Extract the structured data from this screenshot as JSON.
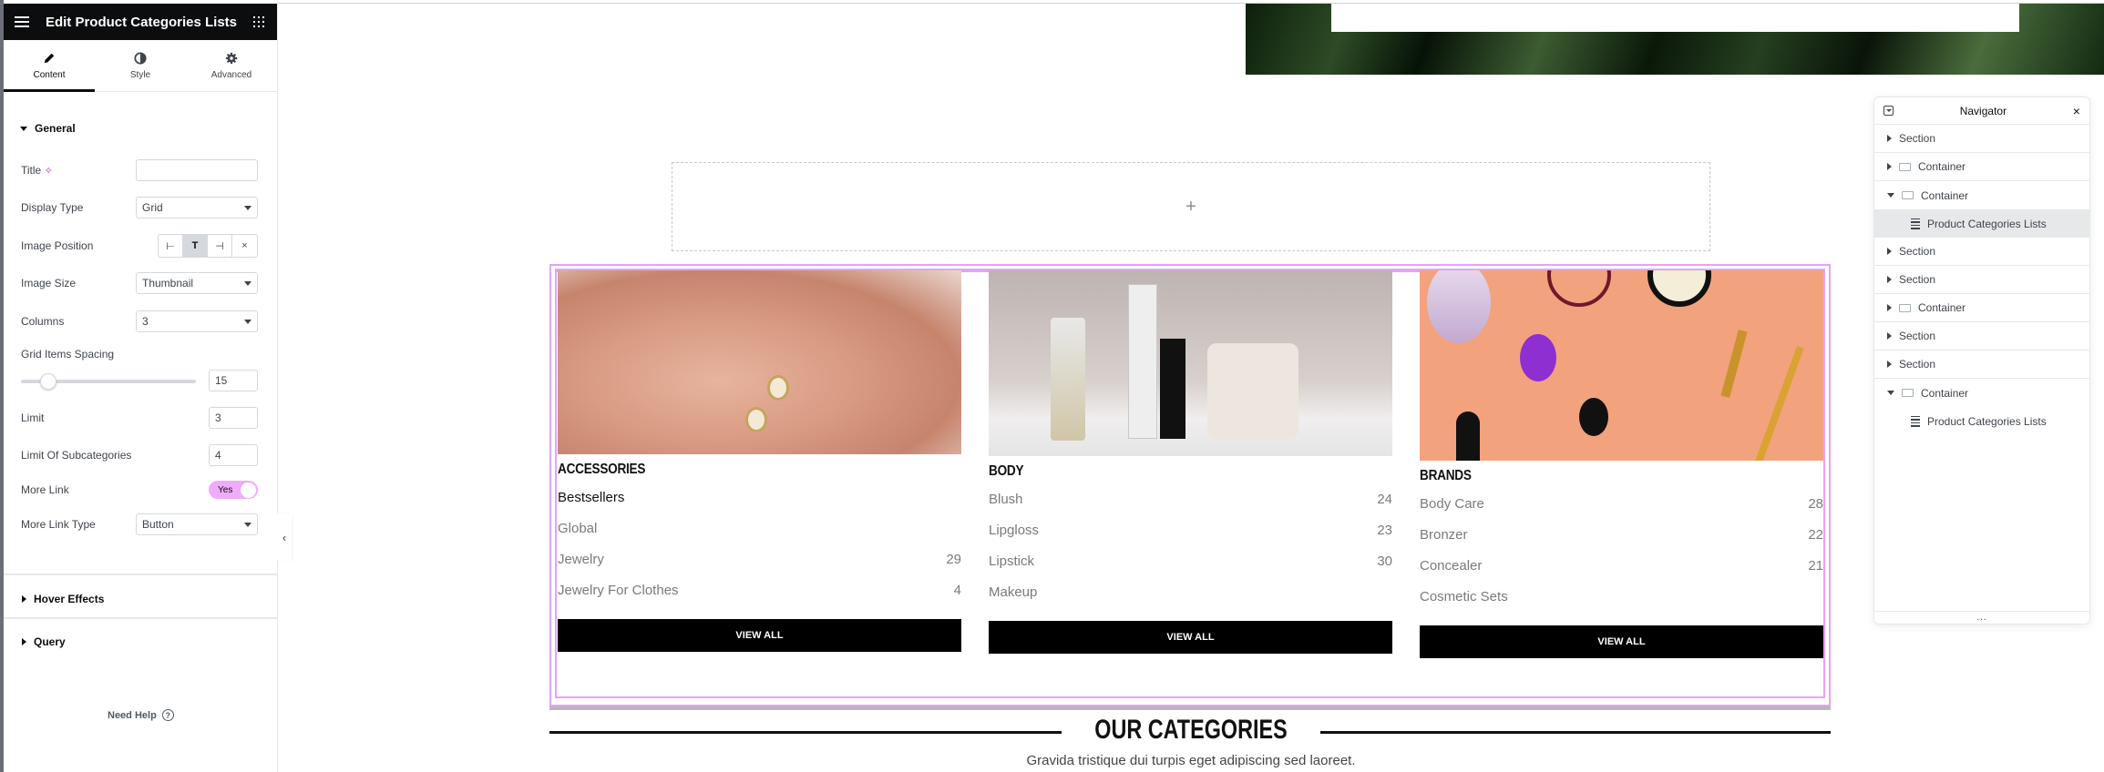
{
  "panel": {
    "title": "Edit Product Categories Lists",
    "tabs": [
      {
        "label": "Content",
        "icon": "pencil-icon"
      },
      {
        "label": "Style",
        "icon": "contrast-icon"
      },
      {
        "label": "Advanced",
        "icon": "gear-icon"
      }
    ],
    "general": {
      "heading": "General",
      "title_label": "Title",
      "title_value": "",
      "display_type_label": "Display Type",
      "display_type_value": "Grid",
      "image_position_label": "Image Position",
      "image_position_options": [
        "⊢",
        "T",
        "⊣",
        "×"
      ],
      "image_size_label": "Image Size",
      "image_size_value": "Thumbnail",
      "columns_label": "Columns",
      "columns_value": "3",
      "spacing_label": "Grid Items Spacing",
      "spacing_value": "15",
      "limit_label": "Limit",
      "limit_value": "3",
      "sub_limit_label": "Limit Of Subcategories",
      "sub_limit_value": "4",
      "more_link_label": "More Link",
      "more_link_value": "Yes",
      "more_link_type_label": "More Link Type",
      "more_link_type_value": "Button"
    },
    "hover_effects": "Hover Effects",
    "query": "Query",
    "need_help": "Need Help"
  },
  "canvas": {
    "add_icon": "+",
    "cards": [
      {
        "title": "ACCESSORIES",
        "items": [
          {
            "name": "Bestsellers",
            "count": ""
          },
          {
            "name": "Global",
            "count": ""
          },
          {
            "name": "Jewelry",
            "count": "29"
          },
          {
            "name": "Jewelry For Clothes",
            "count": "4"
          }
        ],
        "button": "VIEW ALL"
      },
      {
        "title": "BODY",
        "items": [
          {
            "name": "Blush",
            "count": "24"
          },
          {
            "name": "Lipgloss",
            "count": "23"
          },
          {
            "name": "Lipstick",
            "count": "30"
          },
          {
            "name": "Makeup",
            "count": ""
          }
        ],
        "button": "VIEW ALL"
      },
      {
        "title": "BRANDS",
        "items": [
          {
            "name": "Body Care",
            "count": "28"
          },
          {
            "name": "Bronzer",
            "count": "22"
          },
          {
            "name": "Concealer",
            "count": "21"
          },
          {
            "name": "Cosmetic Sets",
            "count": ""
          }
        ],
        "button": "VIEW ALL"
      }
    ],
    "section_title": "OUR CATEGORIES",
    "section_subtitle": "Gravida tristique dui turpis eget adipiscing sed laoreet."
  },
  "navigator": {
    "title": "Navigator",
    "items": [
      {
        "label": "Section",
        "type": "section",
        "state": "collapsed"
      },
      {
        "label": "Container",
        "type": "container",
        "state": "collapsed"
      },
      {
        "label": "Container",
        "type": "container",
        "state": "expanded"
      },
      {
        "label": "Product Categories Lists",
        "type": "widget",
        "state": "selected"
      },
      {
        "label": "Section",
        "type": "section",
        "state": "collapsed"
      },
      {
        "label": "Section",
        "type": "section",
        "state": "collapsed"
      },
      {
        "label": "Container",
        "type": "container",
        "state": "collapsed"
      },
      {
        "label": "Section",
        "type": "section",
        "state": "collapsed"
      },
      {
        "label": "Section",
        "type": "section",
        "state": "collapsed"
      },
      {
        "label": "Container",
        "type": "container",
        "state": "expanded"
      },
      {
        "label": "Product Categories Lists",
        "type": "widget",
        "state": "child"
      }
    ],
    "footer": "..."
  },
  "colors": {
    "accent": "#e6a2f7",
    "toggle_on": "#f0abfc",
    "header_bg": "#0c0d0e"
  }
}
